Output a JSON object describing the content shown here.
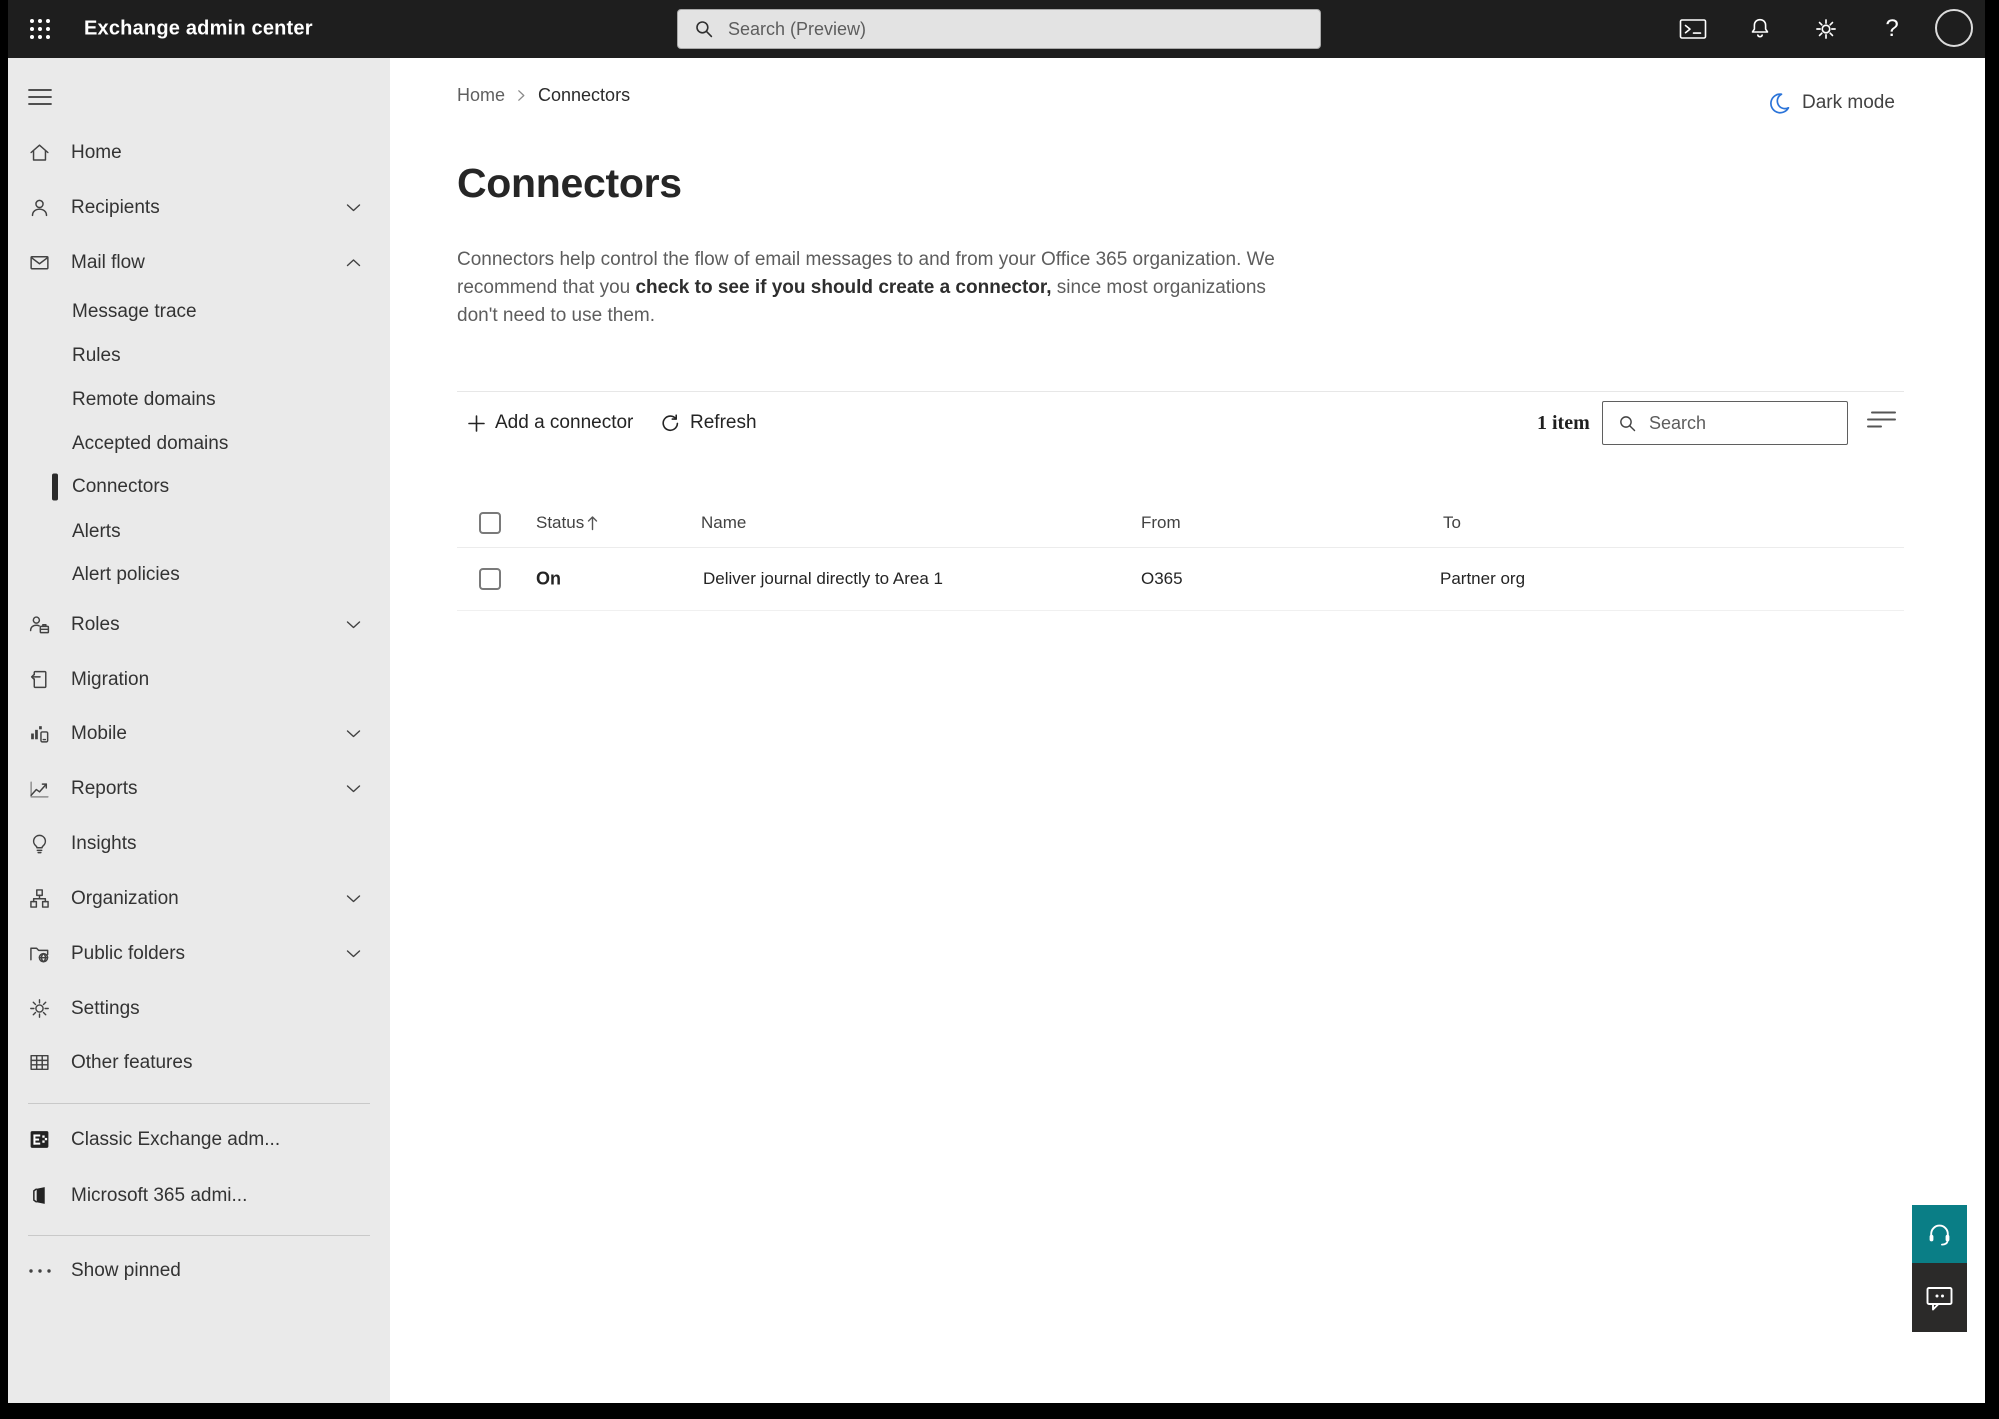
{
  "topbar": {
    "title": "Exchange admin center",
    "search_placeholder": "Search (Preview)",
    "help_glyph": "?"
  },
  "sidebar": {
    "items": [
      {
        "label": "Home"
      },
      {
        "label": "Recipients"
      },
      {
        "label": "Mail flow"
      },
      {
        "label": "Message trace"
      },
      {
        "label": "Rules"
      },
      {
        "label": "Remote domains"
      },
      {
        "label": "Accepted domains"
      },
      {
        "label": "Connectors"
      },
      {
        "label": "Alerts"
      },
      {
        "label": "Alert policies"
      },
      {
        "label": "Roles"
      },
      {
        "label": "Migration"
      },
      {
        "label": "Mobile"
      },
      {
        "label": "Reports"
      },
      {
        "label": "Insights"
      },
      {
        "label": "Organization"
      },
      {
        "label": "Public folders"
      },
      {
        "label": "Settings"
      },
      {
        "label": "Other features"
      },
      {
        "label": "Classic Exchange adm..."
      },
      {
        "label": "Microsoft 365 admi..."
      },
      {
        "label": "Show pinned"
      }
    ],
    "selected": "Connectors"
  },
  "breadcrumb": {
    "home": "Home",
    "current": "Connectors"
  },
  "header": {
    "dark_mode_label": "Dark mode"
  },
  "page": {
    "title": "Connectors",
    "desc_pre": "Connectors help control the flow of email messages to and from your Office 365 organization. We recommend that you ",
    "desc_link": "check to see if you should create a connector,",
    "desc_post": " since most organizations don't need to use them."
  },
  "toolbar": {
    "add_label": "Add a connector",
    "refresh_label": "Refresh",
    "item_count": "1 item",
    "search_placeholder": "Search"
  },
  "table": {
    "headers": {
      "status": "Status",
      "name": "Name",
      "from": "From",
      "to": "To"
    },
    "rows": [
      {
        "status": "On",
        "name": "Deliver journal directly to Area 1",
        "from": "O365",
        "to": "Partner org"
      }
    ]
  },
  "icons": {
    "app_launcher": "grid-dots",
    "terminal": "powershell-window",
    "bell": "notifications",
    "gear": "settings",
    "question": "help",
    "avatar": "account-circle",
    "moon": "dark-mode-crescent",
    "headset": "support",
    "speech_bubble": "feedback"
  },
  "colors": {
    "topbar_bg": "#1e1e1e",
    "sidebar_bg": "#eaeaea",
    "teal_accent": "#0a7e86",
    "feedback_bg": "#2b2a29",
    "moon_blue": "#2b74d9",
    "selected_indicator": "#2b2b2b"
  }
}
